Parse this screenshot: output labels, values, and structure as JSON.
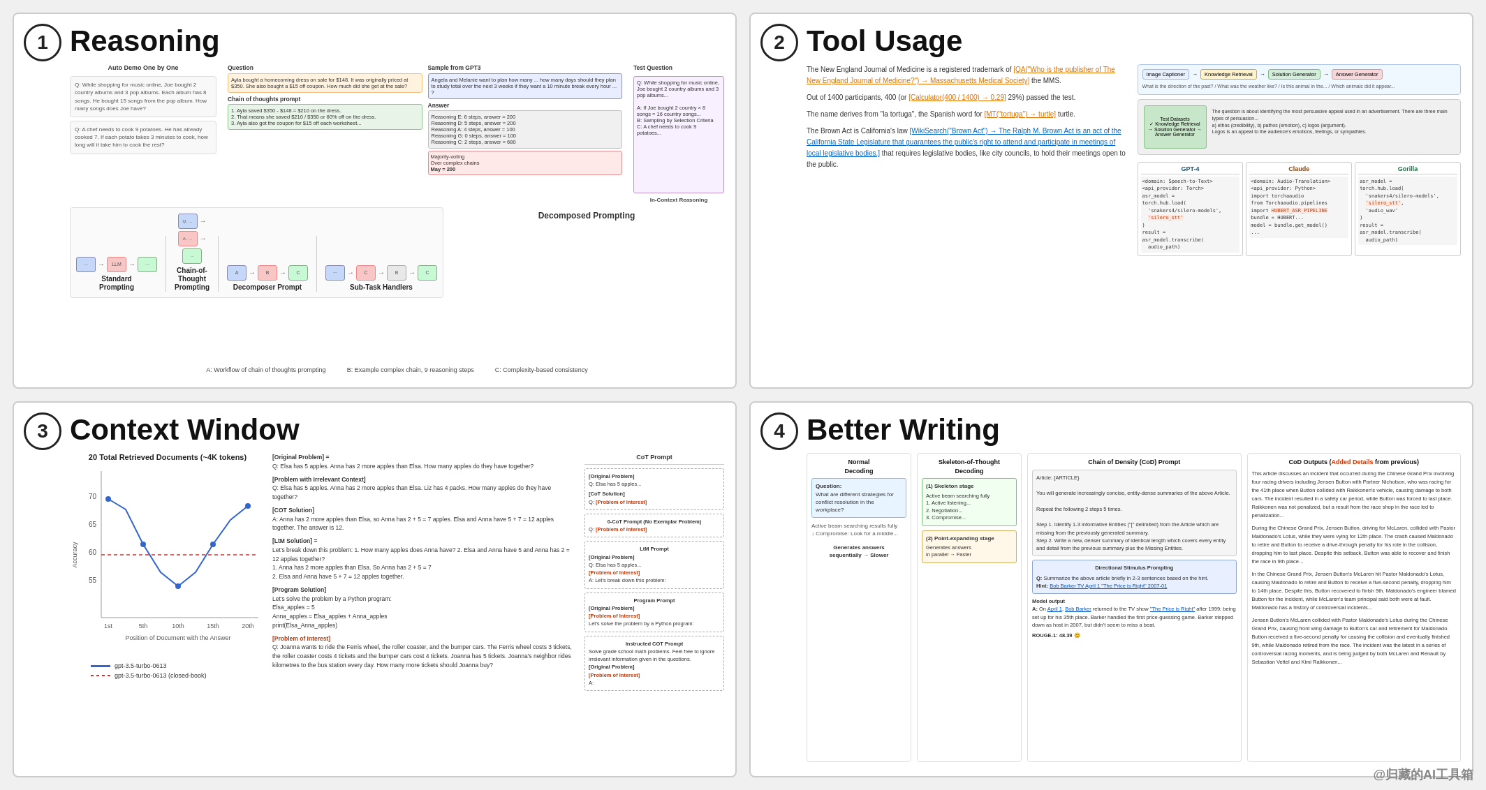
{
  "cards": [
    {
      "number": "1",
      "title": "Reasoning",
      "section": "top_left"
    },
    {
      "number": "2",
      "title": "Tool Usage",
      "section": "top_right"
    },
    {
      "number": "3",
      "title": "Context Window",
      "section": "bottom_left"
    },
    {
      "number": "4",
      "title": "Better Writing",
      "section": "bottom_right"
    }
  ],
  "card1": {
    "title": "Reasoning",
    "number": "1",
    "diagram_title": "Auto Demo One by One",
    "prompt_types": [
      {
        "label": "Standard\nPrompting",
        "id": "standard"
      },
      {
        "label": "Chain-of-Thought\nPrompting",
        "id": "cot"
      },
      {
        "label": "Decomposer Prompt",
        "id": "decomposer"
      },
      {
        "label": "Sub-Task Handlers",
        "id": "subtask"
      }
    ],
    "bottom_label": "Decomposed Prompting",
    "caption_a": "A: Workflow of chain of thoughts prompting",
    "caption_b": "B: Example complex chain, 9 reasoning steps",
    "caption_c": "C: Complexity-based consistency"
  },
  "card2": {
    "title": "Tool Usage",
    "number": "2",
    "text_paragraphs": [
      "The New England Journal of Medicine is a registered trademark of [QA(\"Who is the publisher of The New England Journal of Medicine?\") → Massachusetts Medical Society] the MMS.",
      "Out of 1400 participants, 400 (or [Calculator(400 / 1400) → 0.29] 29%) passed the test.",
      "The name derives from \"la tortuga\", the Spanish word for [MT(\"tortuga\") → turtle] turtle.",
      "The Brown Act is California's law [WikiSearch(\"Brown Act\") → The Ralph M. Brown Act is an act of the California State Legislature that guarantees the public's right to attend and participate in meetings of local legislative bodies.] that requires legislative bodies, like city councils, to hold their meetings open to the public."
    ],
    "models": [
      "GPT-4",
      "Claude",
      "Gorilla"
    ],
    "majority_label": "Majority-voting\nOver complex chains",
    "majority_value": "May = 200"
  },
  "card3": {
    "title": "Context Window",
    "number": "3",
    "chart_title": "20 Total Retrieved Documents (~4K tokens)",
    "y_label": "Accuracy",
    "x_label": "Position of Document with the Answer",
    "x_ticks": [
      "1st",
      "5th",
      "10th",
      "15th",
      "20th"
    ],
    "y_values": [
      70,
      65,
      60,
      55
    ],
    "legend": [
      {
        "label": "gpt-3.5-turbo-0613",
        "style": "solid",
        "color": "#3366cc"
      },
      {
        "label": "gpt-3.5-turbo-0613 (closed-book)",
        "style": "dashed",
        "color": "#cc3333"
      }
    ],
    "right_sections": [
      {
        "heading": "[Original Problem]",
        "content": "Q: Elsa has 5 apples. Anna has 2 more apples than Elsa. How many apples do they have together?"
      },
      {
        "heading": "[Problem with Irrelevant Context]",
        "content": "Q: Elsa has 5 apples. Anna has 2 more apples than Elsa. Liz has 4 packs. How many apples do they have together?"
      },
      {
        "heading": "[COT Solution]",
        "content": "A: Anna has 2 more apples than Elsa, so Anna has 2 + 5 = 7 apples. Elsa and Anna have 5 + 7 = 12 apples together. The answer is 12."
      }
    ],
    "cot_prompt_label": "CoT Prompt"
  },
  "card4": {
    "title": "Better Writing",
    "number": "4",
    "sections": [
      {
        "title": "Normal\nDecoding",
        "content": "Question: What are different strategies for conflict resolution in the workplace?"
      },
      {
        "title": "Skeleton-of-Thought\nDecoding",
        "content": "(1) Skeleton stage\n(2) Point-expanding stage"
      },
      {
        "title": "Chain of Density (CoD) Prompt",
        "content": "Article: {ARTICLE}\n\nYou will generate increasingly concise, entity-dense summaries of the above Article.\n\nRepeat the following 2 steps 5 times.\n\nStep 1. Identify 1-3 informative Entities (\"[\" delimited) from the Article which are missing from the previously generated summary.\nStep 2. Write a new, denser summary of identical length which covers every entity and detail from the previous summary plus the Missing Entities.\n\nDirectional Stimulus Prompting\n\nQ: Summarize the above article briefly in 2-3 sentences based on the hint.\nHint: Bob Barker TV April 1 \"The Price is Right\" 2007-01\n\nModel output\n\nA: On April 1, Bob Barker returned to the TV show \"The Price is Right\" after 1999; being set up for his 35th place. Barker handled the first price-guessing game. Barker stepped down as host in 2007, but didn't seem to miss a beat.\n\nROUGE-1: 48.39"
      },
      {
        "title": "CoD Outputs (Added Details from previous)",
        "content": "This article discusses an incident that occurred during the Chinese Grand Prix involving four racing drivers including Jensen Button with Partner Nicholson, who was racing for the 41th place when Button collided with Raikkonen's vehicle, causing damage to both cars. The incident resulted in a safety car period, while Button was forced to last place. Raikkonen was not penalized, but a result from the race shop in the race led to penalization..."
      }
    ]
  },
  "watermark": "@归藏的AI工具箱"
}
